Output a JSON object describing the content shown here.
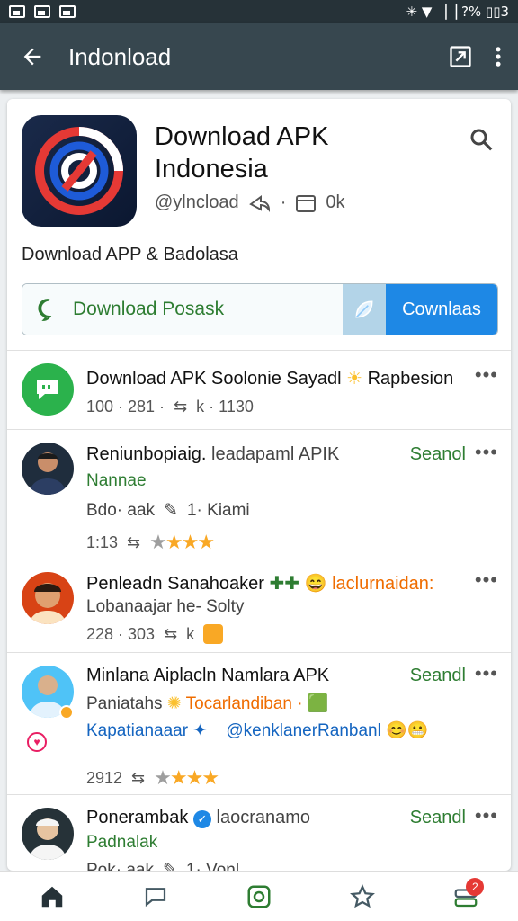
{
  "status_bar": {
    "right_text": "✳ ▼ ▕▕ ?% ▯▯3"
  },
  "app_bar": {
    "title": "Indonload"
  },
  "app": {
    "name": "Download APK Indonesia",
    "handle": "@ylncload",
    "share_count": "0k",
    "description": "Download APP & Badolasa"
  },
  "download_bar": {
    "text": "Download Posask",
    "button_label": "Cownlaas"
  },
  "feed": [
    {
      "name": "Download APK Soolonie Sayadl",
      "name_suffix": "Rapbesion",
      "meta": "100 · 281 ·",
      "meta_suffix": "k · 1130"
    },
    {
      "name": "Reniunbopiaig.",
      "name_extra": "leadapaml APIK",
      "tag": "Seanol",
      "sub": "Nannae",
      "line2": "Bdo· aak",
      "line2_suffix": "1· Kiami",
      "meta": "1:13"
    },
    {
      "name": "Penleadn Sanahoaker",
      "name_suffix": "laclurnaidan:",
      "sub": "Lobanaajar he- Solty",
      "meta": "228 · 303",
      "meta_suffix": "k"
    },
    {
      "name": "Minlana Aiplacln Namlara APK",
      "tag": "Seandl",
      "sub": "Paniatahs",
      "sub_suffix": "Tocarlandiban ·",
      "link1": "Kapatianaaar",
      "link2": "@kenklanerRanbanl",
      "meta": "2912"
    },
    {
      "name": "Ponerambak",
      "name_extra": "laocranamo",
      "tag": "Seandl",
      "sub": "Padnalak",
      "line2": "Pok· aak",
      "line2_suffix": "1· Vonl"
    }
  ],
  "bottom_nav": {
    "badge_count": "2"
  }
}
